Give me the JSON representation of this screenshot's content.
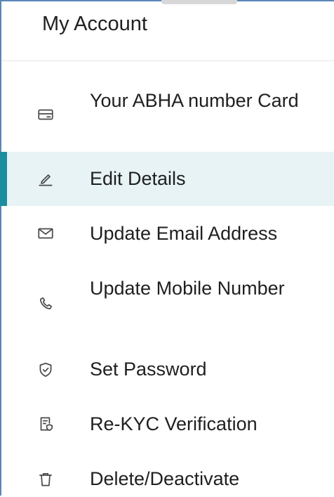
{
  "header": {
    "title": "My Account"
  },
  "menu": {
    "items": [
      {
        "label": "Your ABHA number Card",
        "icon": "card-icon"
      },
      {
        "label": "Edit Details",
        "icon": "pencil-icon",
        "active": true
      },
      {
        "label": "Update Email Address",
        "icon": "envelope-icon"
      },
      {
        "label": "Update Mobile Number",
        "icon": "phone-icon"
      },
      {
        "label": "Set Password",
        "icon": "shield-check-icon"
      },
      {
        "label": "Re-KYC Verification",
        "icon": "document-shield-icon"
      },
      {
        "label": "Delete/Deactivate",
        "icon": "trash-icon"
      }
    ]
  },
  "colors": {
    "accent": "#1d8ea0",
    "active_background": "#e7f3f5",
    "frame_border": "#5b86b8",
    "text": "#1f1f1f",
    "icon": "#4a4a4a"
  }
}
